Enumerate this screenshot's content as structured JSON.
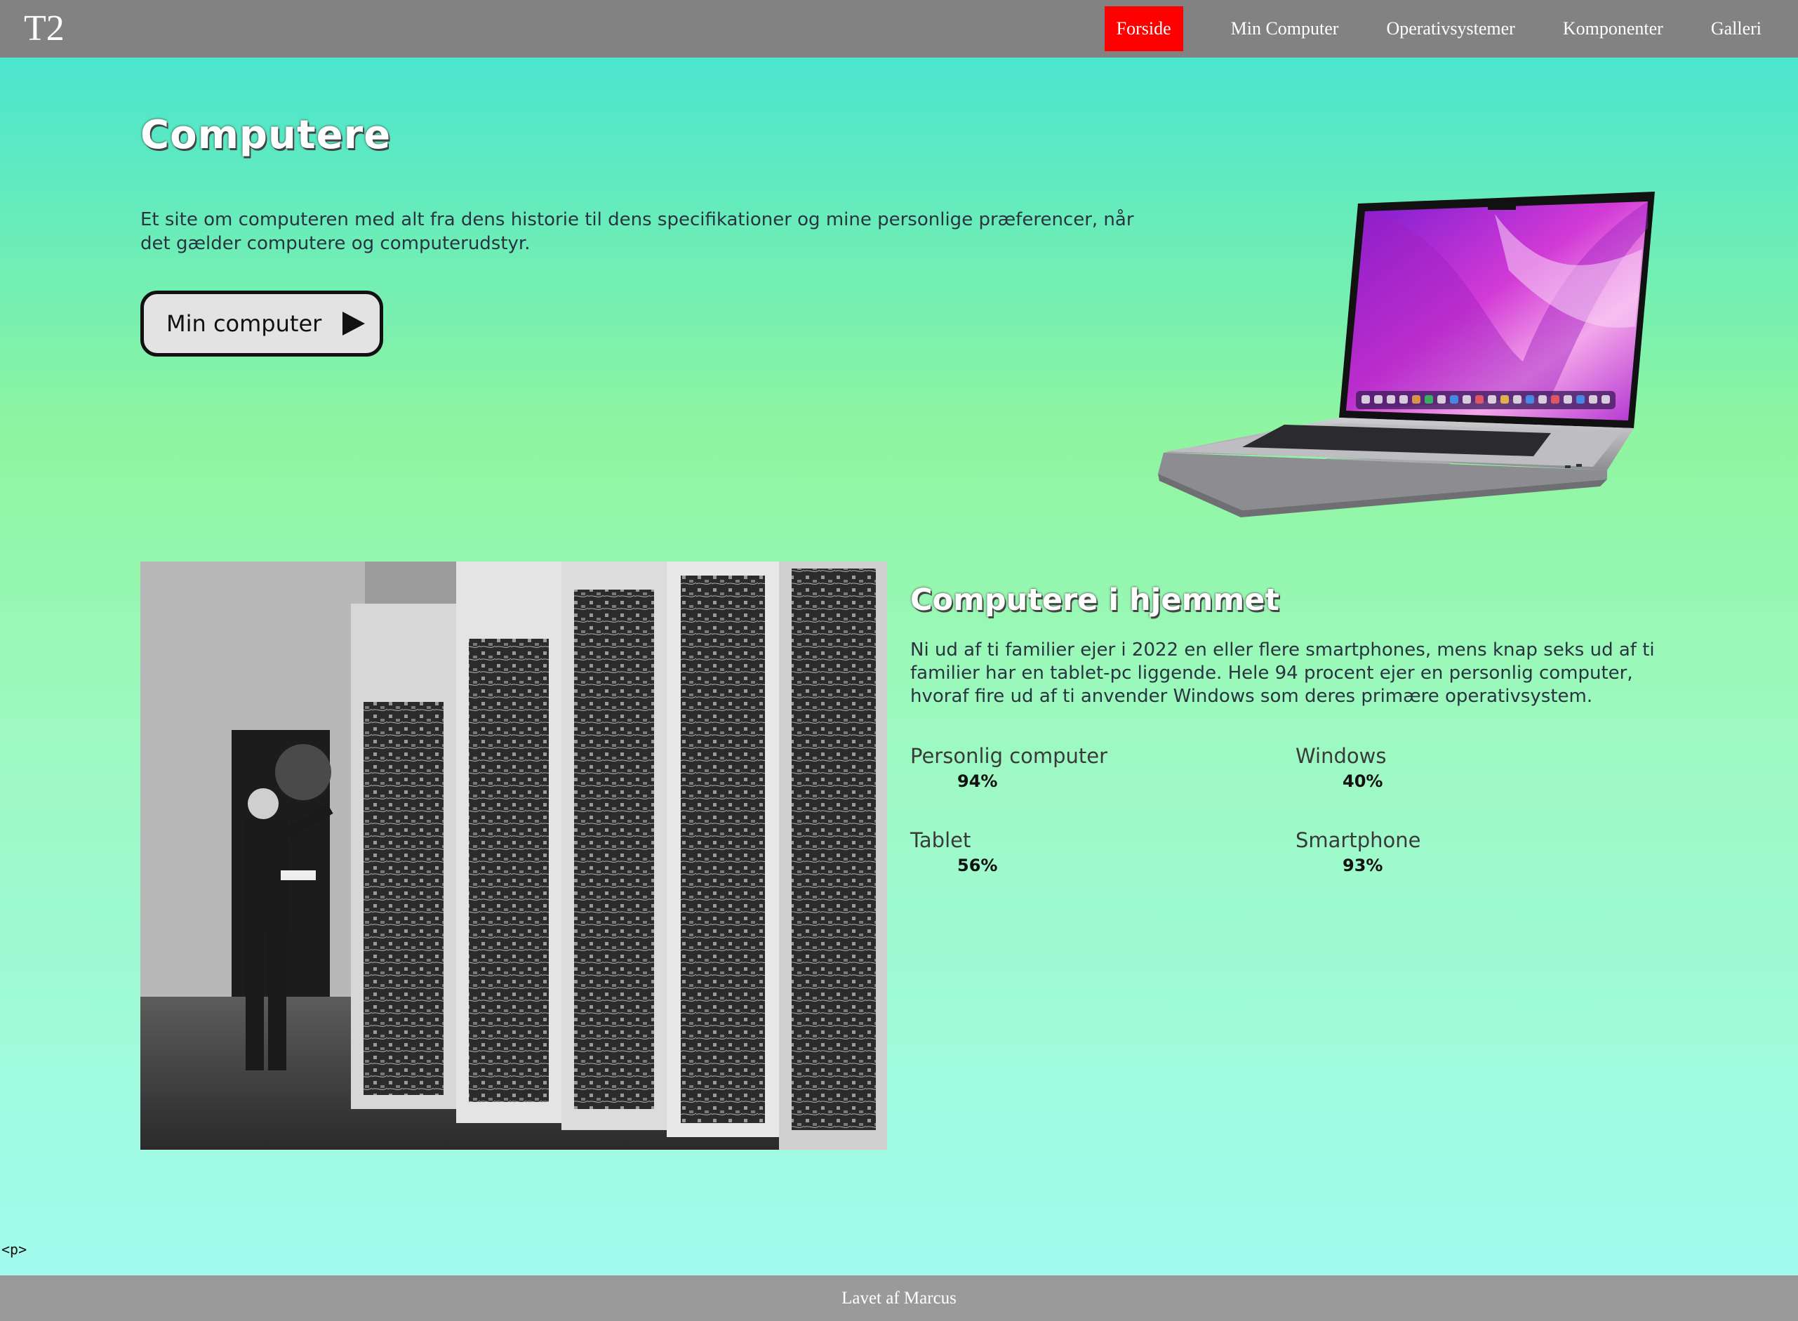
{
  "nav": {
    "logo": "T2",
    "items": [
      {
        "label": "Forside",
        "active": true
      },
      {
        "label": "Min Computer"
      },
      {
        "label": "Operativsystemer"
      },
      {
        "label": "Komponenter"
      },
      {
        "label": "Galleri"
      }
    ],
    "active_color": "#ff0000"
  },
  "hero": {
    "title": "Computere",
    "text": "Et site om computeren med alt fra dens historie til dens specifikationer og mine personlige præferencer, når det gælder computere og computerudstyr.",
    "button_label": "Min computer",
    "button_icon": "play-icon"
  },
  "section": {
    "title": "Computere i hjemmet",
    "text": "Ni ud af ti familier ejer i 2022 en eller flere smartphones, mens knap seks ud af ti familier har en tablet-pc liggende. Hele 94 procent ejer en personlig computer, hvoraf fire ud af ti anvender Windows som deres primære operativsystem.",
    "stats": [
      {
        "label": "Personlig computer",
        "value": "94%"
      },
      {
        "label": "Windows",
        "value": "40%"
      },
      {
        "label": "Tablet",
        "value": "56%"
      },
      {
        "label": "Smartphone",
        "value": "93%"
      }
    ]
  },
  "stray_text": "<p>",
  "footer": {
    "text": "Lavet af Marcus"
  },
  "colors": {
    "nav_bg": "#828282",
    "footer_bg": "#9a9a9a",
    "gradient_top": "#40e3d6",
    "gradient_mid": "#8ff5a0",
    "gradient_bottom": "#a2fbf2"
  }
}
